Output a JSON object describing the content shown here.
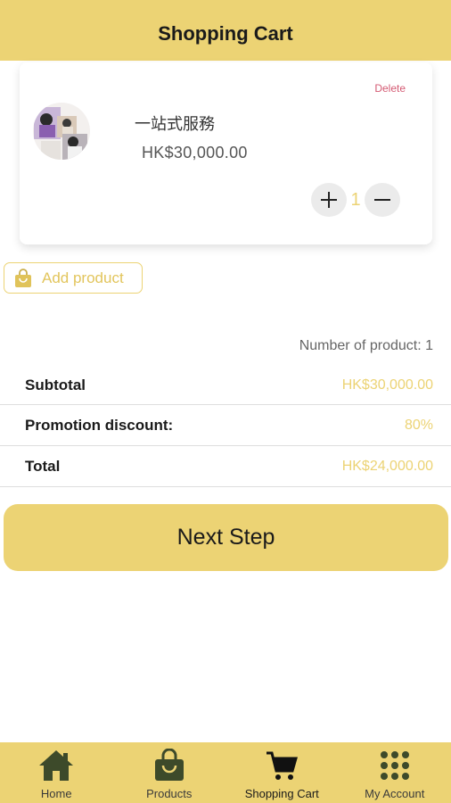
{
  "header": {
    "title": "Shopping Cart"
  },
  "cart": {
    "items": [
      {
        "delete_label": "Delete",
        "name": "一站式服務",
        "price": "HK$30,000.00",
        "quantity": "1",
        "image_icon": "product-photo-collage"
      }
    ]
  },
  "add_product": {
    "label": "Add product",
    "icon": "shopping-bag-icon"
  },
  "summary": {
    "number_of_products": "Number of product: 1",
    "rows": [
      {
        "label": "Subtotal",
        "value": "HK$30,000.00"
      },
      {
        "label": "Promotion discount:",
        "value": "80%"
      },
      {
        "label": "Total",
        "value": "HK$24,000.00"
      }
    ]
  },
  "next_step": {
    "label": "Next Step"
  },
  "bottom_nav": {
    "items": [
      {
        "label": "Home",
        "icon": "home-icon"
      },
      {
        "label": "Products",
        "icon": "shopping-bag-icon"
      },
      {
        "label": "Shopping Cart",
        "icon": "cart-icon",
        "active": true
      },
      {
        "label": "My Account",
        "icon": "grid-icon"
      }
    ]
  },
  "colors": {
    "accent": "#ecd374",
    "accent_text": "#e2c55c",
    "delete": "#d45a73",
    "icon_dark": "#3d4a2a"
  }
}
